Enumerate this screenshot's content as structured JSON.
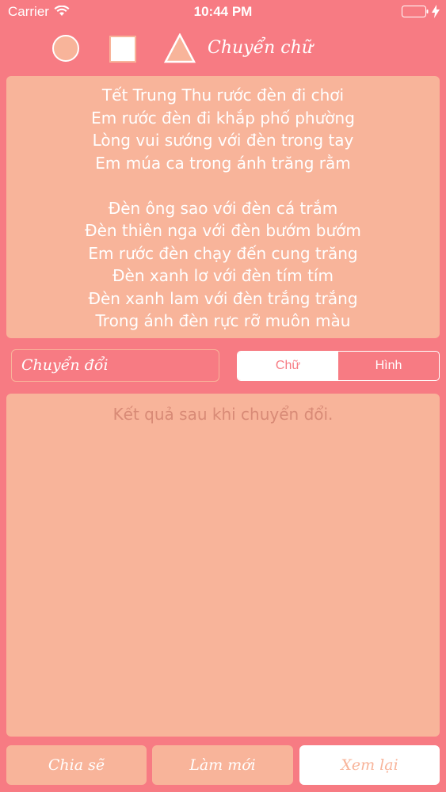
{
  "status_bar": {
    "carrier": "Carrier",
    "time": "10:44 PM"
  },
  "toolbar": {
    "shapes": [
      "circle",
      "square",
      "triangle"
    ],
    "text_label": "Chuyển chữ"
  },
  "input_text": {
    "lines": [
      "Tết Trung Thu rước đèn đi chơi",
      "Em rước đèn đi khắp phố phường",
      "Lòng vui sướng với đèn trong tay",
      "Em múa ca trong ánh trăng rằm",
      "",
      "Đèn ông sao với đèn cá trắm",
      "Đèn thiên nga với đèn bướm bướm",
      "Em rước đèn chạy đến cung trăng",
      "Đèn xanh lơ với đèn tím tím",
      "Đèn xanh lam với đèn trắng trắng",
      "Trong ánh đèn rực rỡ muôn màu"
    ]
  },
  "controls": {
    "convert_label": "Chuyển đổi",
    "segments": [
      "Chữ",
      "Hình"
    ],
    "selected_segment": "Chữ"
  },
  "output": {
    "placeholder": "Kết quả sau khi chuyển đổi."
  },
  "bottom_buttons": {
    "share": "Chia sẽ",
    "refresh": "Làm mới",
    "review": "Xem lại"
  },
  "colors": {
    "background": "#f77b83",
    "panel": "#f8b49a",
    "white": "#ffffff"
  }
}
